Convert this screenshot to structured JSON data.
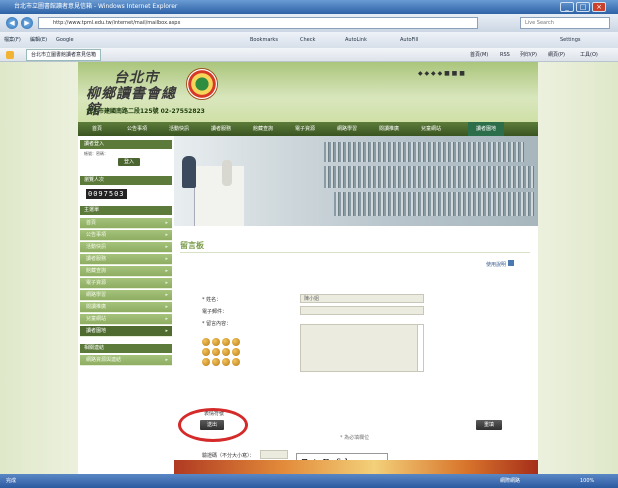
{
  "window": {
    "title": "台北市立圖書館讀者意見信箱 - Windows Internet Explorer",
    "min_label": "_",
    "max_label": "□",
    "close_label": "×"
  },
  "nav": {
    "back_label": "◀",
    "forward_label": "▶",
    "url": "http://www.tpml.edu.tw/internet/mail/mailbox.aspx",
    "search_placeholder": "Live Search"
  },
  "toolbar": {
    "items": [
      "檔案(F)",
      "編輯(E)",
      "檢視(V)",
      "我的最愛(A)",
      "工具(T)",
      "說明(H)",
      "Google",
      "Bookmarks",
      "Check",
      "AutoLink",
      "AutoFill",
      "Settings"
    ]
  },
  "favbar": {
    "tab_label": "台北市立圖書館讀者意見信箱",
    "right_items": [
      "首頁(M)",
      "RSS",
      "列印(P)",
      "網頁(P)",
      "工具(O)"
    ]
  },
  "site": {
    "logo_text_top": "台北市",
    "logo_text_bottom": "柳鄉讀書會總館",
    "address_line": "台北市建國南路二段125號 02-27552823",
    "header_icons": "◆ ◆ ◆ ◆ ■ ■ ■"
  },
  "menu": {
    "items": [
      "首頁",
      "公告事項",
      "活動快訊",
      "讀者服務",
      "館藏查詢",
      "電子資源",
      "網路學習",
      "閱讀推廣",
      "兒童網站",
      "讀者園地"
    ]
  },
  "sidebar": {
    "login_head": "讀者登入",
    "login_hint": "帳號：密碼：",
    "login_button": "登入",
    "visitors_head": "瀏覽人次",
    "counter": "0097503",
    "section_head": "主選單",
    "items": [
      "首頁",
      "公告事項",
      "活動快訊",
      "讀者服務",
      "館藏查詢",
      "電子資源",
      "網路學習",
      "閱讀推廣",
      "兒童網站",
      "讀者園地"
    ],
    "related_head": "相關連結",
    "related_item": "網路資源與連結"
  },
  "content": {
    "title": "留言板",
    "pdf_link": "使用說明",
    "name_label": "* 姓名：",
    "name_value": "陳小姐",
    "email_label": "電子郵件：",
    "email_value": "",
    "message_label": "* 留言內容：",
    "emoticons_label": "表情符號",
    "captcha_label": "驗證碼（不分大小寫）：",
    "captcha_text": "7tBfk",
    "refresh_hint": "重新產生",
    "submit_label": "送出",
    "reset_label": "重填",
    "required_note": "* 為必填欄位"
  },
  "status": {
    "left": "完成",
    "zone": "網際網路",
    "zoom": "100%"
  }
}
